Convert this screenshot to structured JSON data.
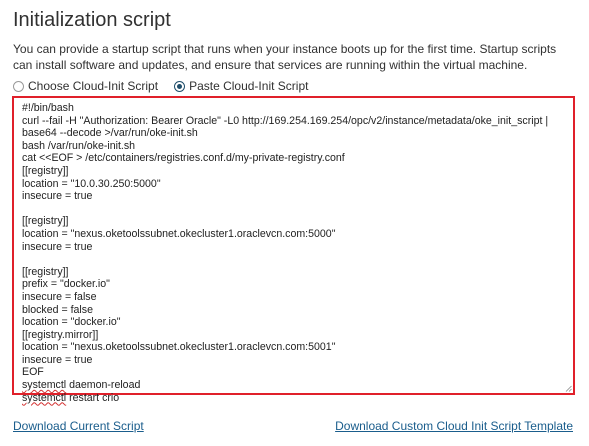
{
  "section": {
    "title": "Initialization script",
    "description": "You can provide a startup script that runs when your instance boots up for the first time. Startup scripts can install software and updates, and ensure that services are running within the virtual machine."
  },
  "radio_options": [
    {
      "label": "Choose Cloud-Init Script",
      "selected": false
    },
    {
      "label": "Paste Cloud-Init Script",
      "selected": true
    }
  ],
  "script_lines": [
    "#!/bin/bash",
    "curl --fail -H \"Authorization: Bearer Oracle\" -L0 http://169.254.169.254/opc/v2/instance/metadata/oke_init_script |",
    "base64 --decode >/var/run/oke-init.sh",
    "bash /var/run/oke-init.sh",
    "cat <<EOF > /etc/containers/registries.conf.d/my-private-registry.conf",
    "[[registry]]",
    "location = \"10.0.30.250:5000\"",
    "insecure = true",
    "",
    "[[registry]]",
    "location = \"nexus.oketoolssubnet.okecluster1.oraclevcn.com:5000\"",
    "insecure = true",
    "",
    "[[registry]]",
    "prefix = \"docker.io\"",
    "insecure = false",
    "blocked = false",
    "location = \"docker.io\"",
    "[[registry.mirror]]",
    "location = \"nexus.oketoolssubnet.okecluster1.oraclevcn.com:5001\"",
    "insecure = true",
    "EOF"
  ],
  "script_spellflagged": {
    "line23_cmd": "systemctl",
    "line23_rest": " daemon-reload",
    "line24_cmd": "systemctl",
    "line24_rest": " restart crio"
  },
  "links": {
    "download_current": "Download Current Script",
    "download_template": "Download Custom Cloud Init Script Template"
  },
  "colors": {
    "highlight_border": "#e0202a",
    "link": "#1a5d8c",
    "radio_selected": "#1f4e6b"
  }
}
